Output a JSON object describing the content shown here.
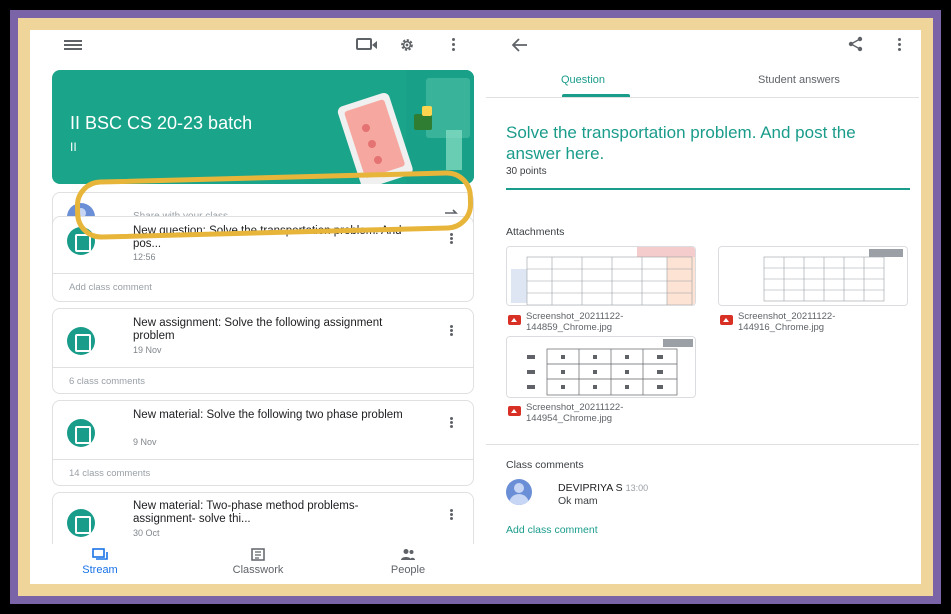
{
  "stream": {
    "class_name": "II BSC CS 20-23 batch",
    "class_subtitle": "II",
    "share_placeholder": "Share with your class...",
    "posts": [
      {
        "title": "New question: Solve the transportation problem. And pos...",
        "date": "12:56",
        "comments": "Add class comment"
      },
      {
        "title": "New assignment: Solve the following assignment problem",
        "date": "19 Nov",
        "comments": "6 class comments"
      },
      {
        "title": "New material: Solve the following two phase problem",
        "date": "9 Nov",
        "comments": "14 class comments"
      },
      {
        "title": "New material: Two-phase method problems- assignment- solve thi...",
        "date": "30 Oct",
        "comments": ""
      }
    ]
  },
  "nav": {
    "stream": "Stream",
    "classwork": "Classwork",
    "people": "People"
  },
  "question": {
    "tab_question": "Question",
    "tab_answers": "Student answers",
    "title": "Solve the transportation problem. And post the answer here.",
    "points": "30 points",
    "attachments_label": "Attachments",
    "attachments": [
      {
        "name": "Screenshot_20211122-144859_Chrome.jpg"
      },
      {
        "name": "Screenshot_20211122-144916_Chrome.jpg"
      },
      {
        "name": "Screenshot_20211122-144954_Chrome.jpg"
      }
    ],
    "comments_label": "Class comments",
    "comment": {
      "author": "DEVIPRIYA S",
      "time": "13:00",
      "text": "Ok mam"
    },
    "add_comment": "Add class comment"
  },
  "colors": {
    "accent": "#1a9c8b",
    "banner": "#1aa58a",
    "highlight": "#e8b53b",
    "frame_purple": "#7b63a8",
    "frame_yellow": "#efd59a",
    "nav_active": "#1a73e8"
  }
}
